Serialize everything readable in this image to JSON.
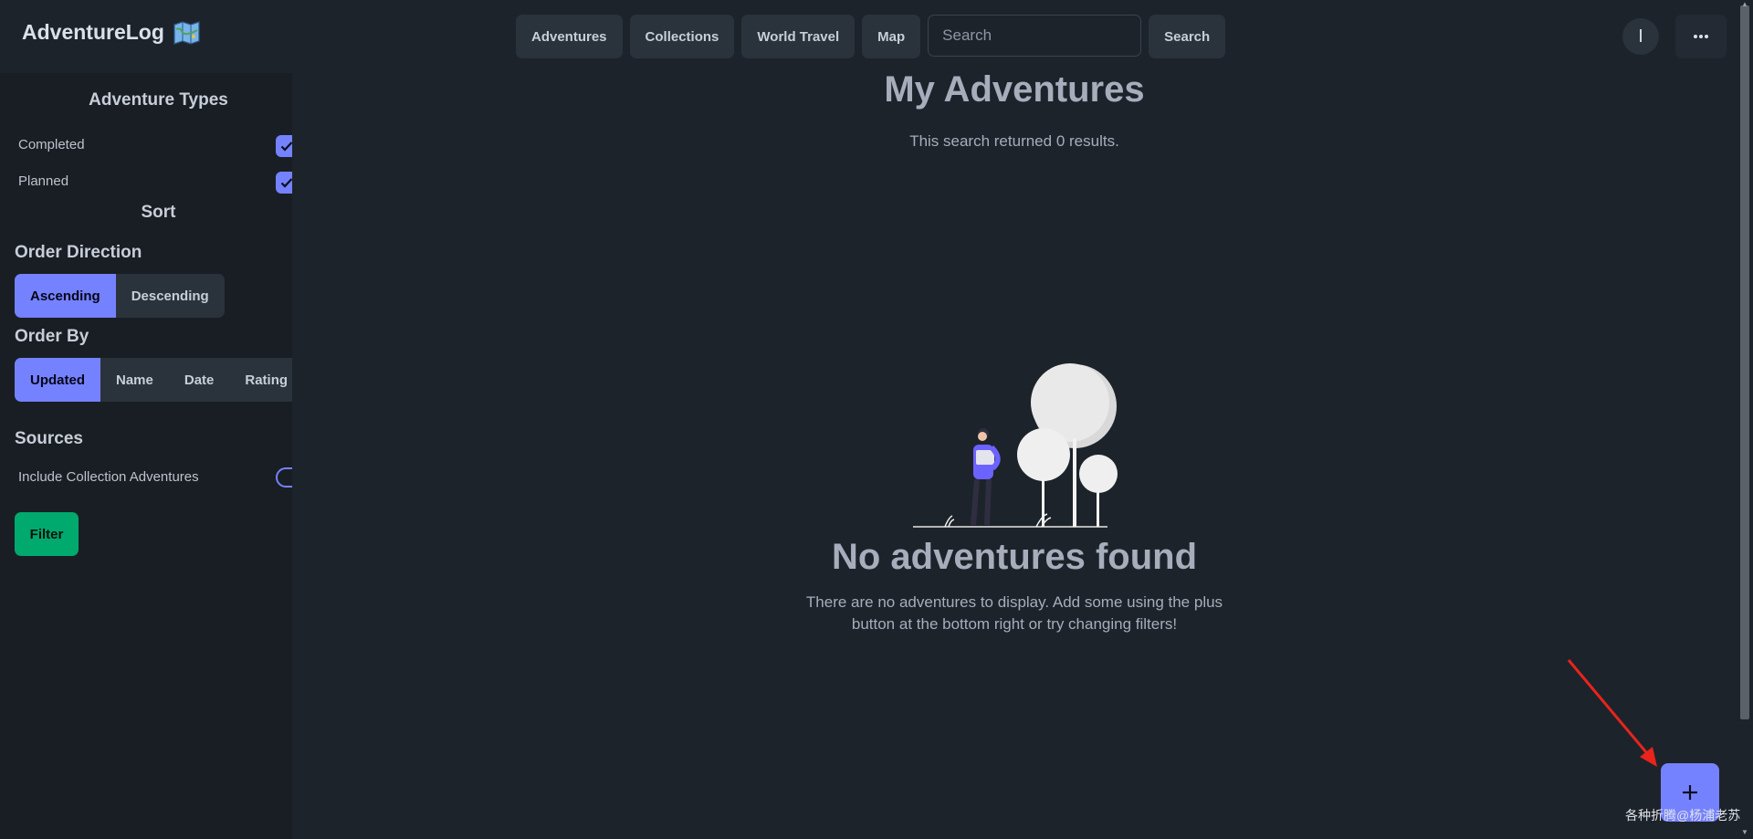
{
  "navbar": {
    "brand": "AdventureLog",
    "brand_icon": "map-icon",
    "links": [
      "Adventures",
      "Collections",
      "World Travel",
      "Map"
    ],
    "search_placeholder": "Search",
    "search_button": "Search",
    "avatar_initial": "I",
    "menu_icon": "ellipsis-icon"
  },
  "sidebar": {
    "types_title": "Adventure Types",
    "types": [
      {
        "label": "Completed",
        "checked": true
      },
      {
        "label": "Planned",
        "checked": true
      }
    ],
    "sort_title": "Sort",
    "order_direction_label": "Order Direction",
    "order_direction": [
      "Ascending",
      "Descending"
    ],
    "order_by_label": "Order By",
    "order_by": [
      "Updated",
      "Name",
      "Date",
      "Rating"
    ],
    "sources_label": "Sources",
    "include_collection": "Include Collection Adventures",
    "filter_button": "Filter"
  },
  "main": {
    "title": "My Adventures",
    "results": "This search returned 0 results.",
    "empty_title": "No adventures found",
    "empty_desc": "There are no adventures to display. Add some using the plus button at the bottom right or try changing filters!"
  },
  "fab": {
    "icon": "plus-icon"
  },
  "watermark": "各种折腾@杨浦老苏",
  "colors": {
    "background": "#1d232a",
    "sidebar": "#191e24",
    "primary": "#7582ff",
    "success": "#00a96e",
    "annotation_arrow": "#e8241c"
  }
}
